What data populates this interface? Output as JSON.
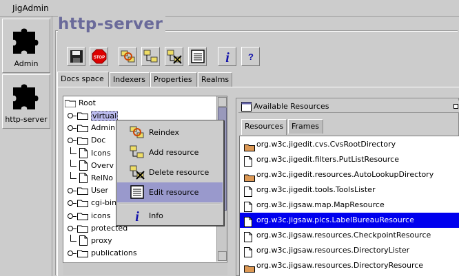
{
  "menubar": {
    "app_menu": "JigAdmin"
  },
  "nav": [
    {
      "label": "Admin"
    },
    {
      "label": "http-server"
    }
  ],
  "page_title": "http-server",
  "toolbar": [
    {
      "name": "save-button",
      "icon": "floppy-disk-icon"
    },
    {
      "name": "stop-button",
      "icon": "stop-sign-icon",
      "text": "STOP"
    },
    {
      "name": "reindex-button",
      "icon": "reindex-folders-icon"
    },
    {
      "name": "add-resource-button",
      "icon": "add-folder-icon"
    },
    {
      "name": "delete-resource-button",
      "icon": "delete-folder-icon"
    },
    {
      "name": "edit-resource-button",
      "icon": "edit-document-icon"
    },
    {
      "name": "info-button",
      "icon": "info-icon",
      "text": "i"
    },
    {
      "name": "help-button",
      "icon": "help-icon",
      "text": "?"
    }
  ],
  "tabs": [
    {
      "label": "Docs space",
      "active": true
    },
    {
      "label": "Indexers",
      "active": false
    },
    {
      "label": "Properties",
      "active": false
    },
    {
      "label": "Realms",
      "active": false
    }
  ],
  "tree": {
    "root": "Root",
    "items": [
      {
        "label": "virtual",
        "type": "folder",
        "expandable": true,
        "selected": true
      },
      {
        "label": "Admin",
        "type": "folder",
        "expandable": true
      },
      {
        "label": "Doc",
        "type": "folder",
        "expandable": true
      },
      {
        "label": "Icons",
        "type": "file"
      },
      {
        "label": "Overv",
        "type": "file"
      },
      {
        "label": "RelNo",
        "type": "file"
      },
      {
        "label": "User",
        "type": "folder",
        "expandable": true
      },
      {
        "label": "cgi-bin",
        "type": "folder",
        "expandable": true
      },
      {
        "label": "icons",
        "type": "folder",
        "expandable": true
      },
      {
        "label": "protected",
        "type": "folder",
        "expandable": true
      },
      {
        "label": "proxy",
        "type": "file"
      },
      {
        "label": "publications",
        "type": "folder",
        "expandable": true
      }
    ]
  },
  "context_menu": [
    {
      "label": "Reindex",
      "icon": "reindex-folders-icon"
    },
    {
      "label": "Add resource",
      "icon": "add-folder-icon"
    },
    {
      "label": "Delete resource",
      "icon": "delete-folder-icon"
    },
    {
      "label": "Edit resource",
      "icon": "edit-document-icon",
      "highlighted": true
    },
    {
      "label": "Info",
      "icon": "info-icon",
      "separator_before": true
    }
  ],
  "resources_window": {
    "title": "Available Resources",
    "tabs": [
      {
        "label": "Resources",
        "active": true
      },
      {
        "label": "Frames",
        "active": false
      }
    ],
    "items": [
      {
        "label": "org.w3c.jigedit.cvs.CvsRootDirectory",
        "type": "folder"
      },
      {
        "label": "org.w3c.jigedit.filters.PutListResource",
        "type": "file"
      },
      {
        "label": "org.w3c.jigedit.resources.AutoLookupDirectory",
        "type": "folder"
      },
      {
        "label": "org.w3c.jigedit.tools.ToolsLister",
        "type": "file"
      },
      {
        "label": "org.w3c.jigsaw.map.MapResource",
        "type": "file"
      },
      {
        "label": "org.w3c.jigsaw.pics.LabelBureauResource",
        "type": "file",
        "selected": true
      },
      {
        "label": "org.w3c.jigsaw.resources.CheckpointResource",
        "type": "file"
      },
      {
        "label": "org.w3c.jigsaw.resources.DirectoryLister",
        "type": "file"
      },
      {
        "label": "org.w3c.jigsaw.resources.DirectoryResource",
        "type": "folder"
      }
    ]
  },
  "colors": {
    "background": "#cccccc",
    "title": "#6a6a9a",
    "selection": "#0000ee",
    "menu_highlight": "#9999cc",
    "folder": "#dd9955"
  }
}
